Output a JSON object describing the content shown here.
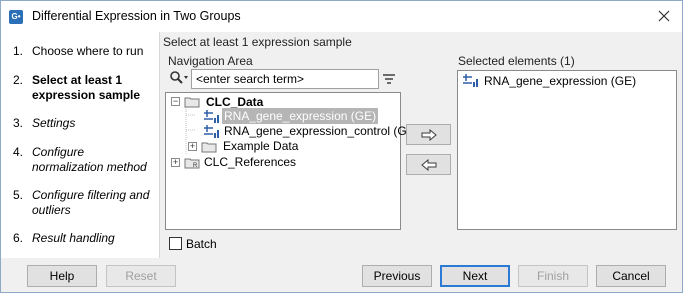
{
  "window": {
    "title": "Differential Expression in Two Groups",
    "app_icon": "G•"
  },
  "steps": [
    {
      "num": "1.",
      "label": "Choose where to run"
    },
    {
      "num": "2.",
      "label": "Select at least 1 expression sample"
    },
    {
      "num": "3.",
      "label": "Settings"
    },
    {
      "num": "4.",
      "label": "Configure normalization method"
    },
    {
      "num": "5.",
      "label": "Configure filtering and outliers"
    },
    {
      "num": "6.",
      "label": "Result handling"
    }
  ],
  "main": {
    "instruction": "Select at least 1 expression sample",
    "navigation_area_label": "Navigation Area",
    "search": {
      "value": "<enter search term>",
      "placeholder": "<enter search term>"
    },
    "tree": {
      "clc_data": "CLC_Data",
      "item1": "RNA_gene_expression (GE)",
      "item2": "RNA_gene_expression_control (GE)",
      "example_data": "Example Data",
      "clc_references": "CLC_References"
    },
    "selected_label": "Selected elements (1)",
    "selected_items": [
      "RNA_gene_expression (GE)"
    ],
    "batch_label": "Batch",
    "batch_checked": false
  },
  "buttons": {
    "help": "Help",
    "reset": "Reset",
    "previous": "Previous",
    "next": "Next",
    "finish": "Finish",
    "cancel": "Cancel"
  },
  "icons": {
    "close": "close-icon",
    "search": "search-icon",
    "filter": "filter-icon",
    "add": "arrow-right-icon",
    "remove": "arrow-left-icon"
  },
  "colors": {
    "accent": "#2b7bd6",
    "selection": "#b5b5b5"
  }
}
